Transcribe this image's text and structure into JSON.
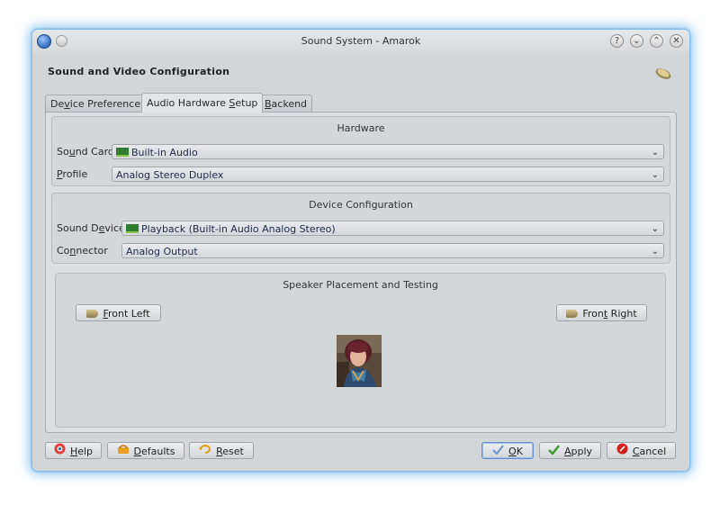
{
  "window": {
    "title": "Sound System - Amarok",
    "title_buttons": [
      "?",
      "⌄",
      "⌃",
      "✕"
    ]
  },
  "header": {
    "title": "Sound and Video Configuration"
  },
  "tabs": [
    {
      "label_pre": "De",
      "label_ul": "v",
      "label_post": "ice Preference"
    },
    {
      "label_pre": "Audio Hardware ",
      "label_ul": "S",
      "label_post": "etup"
    },
    {
      "label_pre": "",
      "label_ul": "B",
      "label_post": "ackend"
    }
  ],
  "hardware": {
    "title": "Hardware",
    "sound_card_label_pre": "So",
    "sound_card_label_ul": "u",
    "sound_card_label_post": "nd Card",
    "sound_card_value": "Built-in Audio",
    "profile_label_pre": "",
    "profile_label_ul": "P",
    "profile_label_post": "rofile",
    "profile_value": "Analog Stereo Duplex"
  },
  "device_config": {
    "title": "Device Configuration",
    "sound_device_label_pre": "Sound D",
    "sound_device_label_ul": "e",
    "sound_device_label_post": "vice",
    "sound_device_value": "Playback (Built-in Audio Analog Stereo)",
    "connector_label_pre": "Co",
    "connector_label_ul": "n",
    "connector_label_post": "nector",
    "connector_value": "Analog Output"
  },
  "speakers": {
    "title": "Speaker Placement and Testing",
    "front_left_ul": "F",
    "front_left_post": "ront Left",
    "front_right_pre": "Fron",
    "front_right_ul": "t",
    "front_right_post": " Right"
  },
  "buttons": {
    "help_ul": "H",
    "help_post": "elp",
    "defaults_ul": "D",
    "defaults_post": "efaults",
    "reset_ul": "R",
    "reset_post": "eset",
    "ok_ul": "O",
    "ok_post": "K",
    "apply_ul": "A",
    "apply_post": "pply",
    "cancel_ul": "C",
    "cancel_post": "ancel"
  },
  "colors": {
    "glow": "#6eb4eb",
    "apply_check": "#3a9a2a",
    "cancel_red": "#d22020",
    "ok_check": "#6a8fc8"
  }
}
